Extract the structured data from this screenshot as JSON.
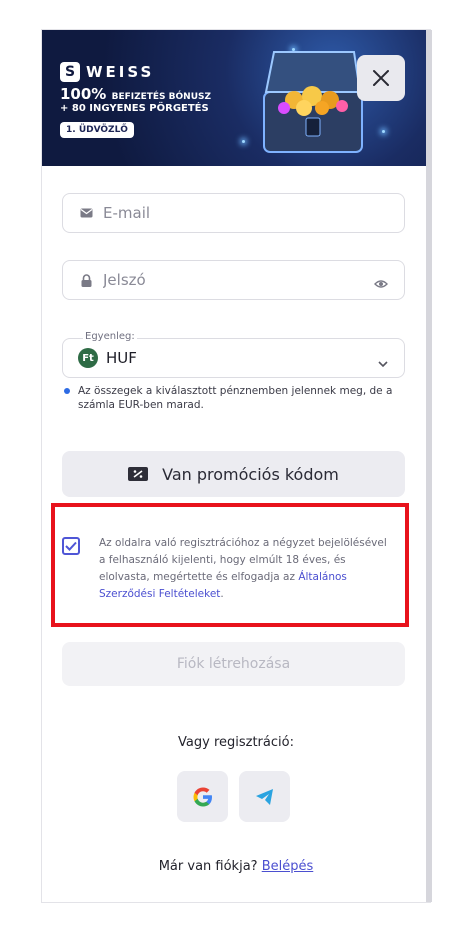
{
  "banner": {
    "brand": "WEISS",
    "logo_letter": "S",
    "bonus_big": "100%",
    "bonus_text": "BEFIZETÉS BÓNUSZ",
    "spins_text": "+ 80 INGYENES PÖRGETÉS",
    "welcome_chip": "1. ÜDVÖZLŐ",
    "close_icon": "close-icon"
  },
  "form": {
    "email_placeholder": "E-mail",
    "password_placeholder": "Jelszó",
    "balance_label": "Egyenleg:",
    "currency_badge": "Ft",
    "currency_value": "HUF",
    "currency_note": "Az összegek a kiválasztott pénznemben jelennek meg, de a számla EUR-ben marad.",
    "promo_button": "Van promóciós kódom",
    "terms_text": "Az oldalra való regisztrációhoz a négyzet bejelölésével a felhasználó kijelenti, hogy elmúlt 18 éves, és elolvasta, megértette és elfogadja az",
    "terms_link": "Általános Szerződési Feltételeket",
    "terms_end": ".",
    "terms_checked": true,
    "create_button": "Fiók létrehozása"
  },
  "social": {
    "or_text": "Vagy regisztráció:",
    "google_icon": "google-icon",
    "telegram_icon": "telegram-icon"
  },
  "footer": {
    "have_account": "Már van fiókja?",
    "login_link": "Belépés"
  },
  "colors": {
    "accent": "#4b4fd0",
    "highlight_border": "#e8121c",
    "banner_bg": "#1a2c63"
  }
}
